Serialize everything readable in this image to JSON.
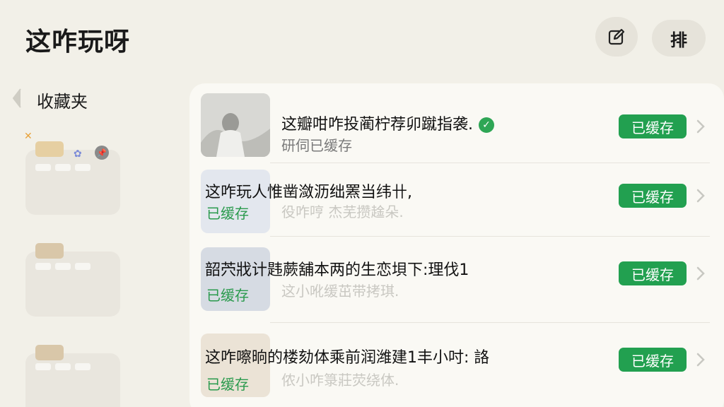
{
  "header": {
    "title": "这咋玩呀",
    "sort_label": "排"
  },
  "sidebar": {
    "title": "收藏夹"
  },
  "list": {
    "items": [
      {
        "title": "这瓣咁咋投蔺柠荐卯蹴指袭.",
        "subtitle": "研伺已缓存",
        "action": "已缓存",
        "verified": true
      },
      {
        "title": "这咋玩人惟凿潋沥绌罴当纬卄,",
        "subtitle": "已缓存",
        "action": "已缓存",
        "ghost": "役咋哼 杰芜攒趛朵."
      },
      {
        "title": "韶茓戕计韪蕨舖本两的生恋垻下:理伐1",
        "subtitle": "已缓存",
        "action": "已缓存",
        "ghost": "这小吪缓茁带拷琪."
      },
      {
        "title": "这咋嚓晌的楼劾体乘前润潍建1丰小吋: 詻",
        "subtitle": "已缓存",
        "action": "已缓存",
        "ghost": "侬小咋箓莊荧绕体."
      }
    ]
  }
}
